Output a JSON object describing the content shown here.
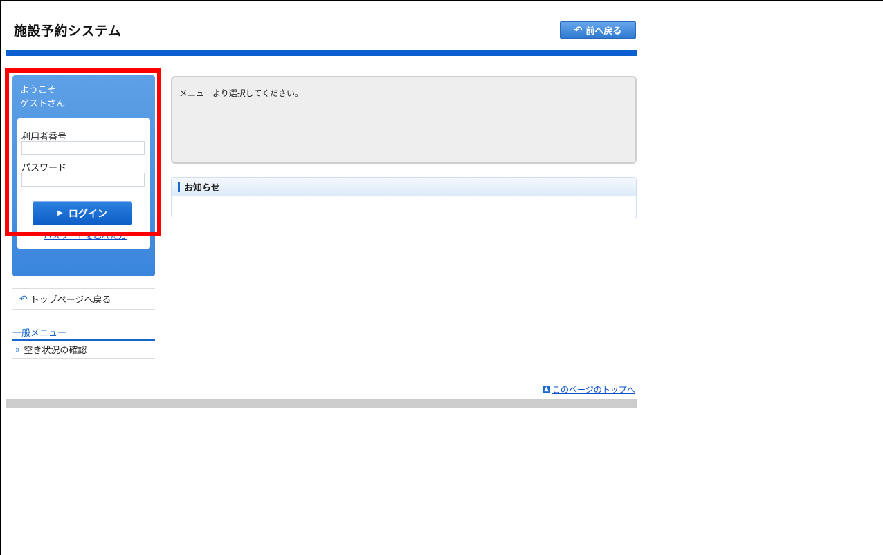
{
  "header": {
    "title": "施設予約システム",
    "back_button": "前へ戻る"
  },
  "login": {
    "welcome_line1": "ようこそ",
    "welcome_line2": "ゲストさん",
    "user_id_label": "利用者番号",
    "user_id_value": "",
    "password_label": "パスワード",
    "password_value": "",
    "login_button": "ログイン",
    "forgot_link": "パスワードを忘れた方"
  },
  "sidebar": {
    "top_link": "トップページへ戻る",
    "menu_heading": "一般メニュー",
    "menu_items": [
      {
        "label": "空き状況の確認"
      }
    ]
  },
  "main": {
    "message": "メニューより選択してください。",
    "news_heading": "お知らせ"
  },
  "footer": {
    "page_top_link": "このページのトップへ"
  },
  "colors": {
    "accent": "#0b5fcf",
    "highlight_outline": "#ff0000"
  }
}
